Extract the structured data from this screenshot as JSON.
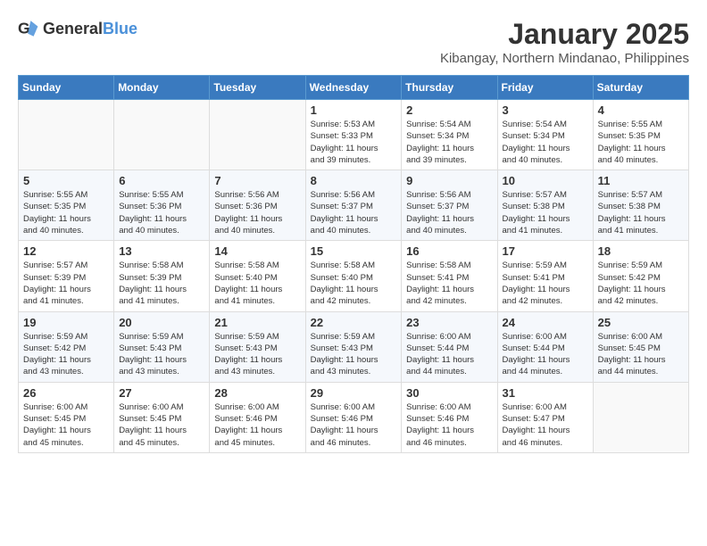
{
  "logo": {
    "general": "General",
    "blue": "Blue"
  },
  "title": "January 2025",
  "subtitle": "Kibangay, Northern Mindanao, Philippines",
  "weekdays": [
    "Sunday",
    "Monday",
    "Tuesday",
    "Wednesday",
    "Thursday",
    "Friday",
    "Saturday"
  ],
  "weeks": [
    [
      {
        "day": "",
        "info": ""
      },
      {
        "day": "",
        "info": ""
      },
      {
        "day": "",
        "info": ""
      },
      {
        "day": "1",
        "info": "Sunrise: 5:53 AM\nSunset: 5:33 PM\nDaylight: 11 hours\nand 39 minutes."
      },
      {
        "day": "2",
        "info": "Sunrise: 5:54 AM\nSunset: 5:34 PM\nDaylight: 11 hours\nand 39 minutes."
      },
      {
        "day": "3",
        "info": "Sunrise: 5:54 AM\nSunset: 5:34 PM\nDaylight: 11 hours\nand 40 minutes."
      },
      {
        "day": "4",
        "info": "Sunrise: 5:55 AM\nSunset: 5:35 PM\nDaylight: 11 hours\nand 40 minutes."
      }
    ],
    [
      {
        "day": "5",
        "info": "Sunrise: 5:55 AM\nSunset: 5:35 PM\nDaylight: 11 hours\nand 40 minutes."
      },
      {
        "day": "6",
        "info": "Sunrise: 5:55 AM\nSunset: 5:36 PM\nDaylight: 11 hours\nand 40 minutes."
      },
      {
        "day": "7",
        "info": "Sunrise: 5:56 AM\nSunset: 5:36 PM\nDaylight: 11 hours\nand 40 minutes."
      },
      {
        "day": "8",
        "info": "Sunrise: 5:56 AM\nSunset: 5:37 PM\nDaylight: 11 hours\nand 40 minutes."
      },
      {
        "day": "9",
        "info": "Sunrise: 5:56 AM\nSunset: 5:37 PM\nDaylight: 11 hours\nand 40 minutes."
      },
      {
        "day": "10",
        "info": "Sunrise: 5:57 AM\nSunset: 5:38 PM\nDaylight: 11 hours\nand 41 minutes."
      },
      {
        "day": "11",
        "info": "Sunrise: 5:57 AM\nSunset: 5:38 PM\nDaylight: 11 hours\nand 41 minutes."
      }
    ],
    [
      {
        "day": "12",
        "info": "Sunrise: 5:57 AM\nSunset: 5:39 PM\nDaylight: 11 hours\nand 41 minutes."
      },
      {
        "day": "13",
        "info": "Sunrise: 5:58 AM\nSunset: 5:39 PM\nDaylight: 11 hours\nand 41 minutes."
      },
      {
        "day": "14",
        "info": "Sunrise: 5:58 AM\nSunset: 5:40 PM\nDaylight: 11 hours\nand 41 minutes."
      },
      {
        "day": "15",
        "info": "Sunrise: 5:58 AM\nSunset: 5:40 PM\nDaylight: 11 hours\nand 42 minutes."
      },
      {
        "day": "16",
        "info": "Sunrise: 5:58 AM\nSunset: 5:41 PM\nDaylight: 11 hours\nand 42 minutes."
      },
      {
        "day": "17",
        "info": "Sunrise: 5:59 AM\nSunset: 5:41 PM\nDaylight: 11 hours\nand 42 minutes."
      },
      {
        "day": "18",
        "info": "Sunrise: 5:59 AM\nSunset: 5:42 PM\nDaylight: 11 hours\nand 42 minutes."
      }
    ],
    [
      {
        "day": "19",
        "info": "Sunrise: 5:59 AM\nSunset: 5:42 PM\nDaylight: 11 hours\nand 43 minutes."
      },
      {
        "day": "20",
        "info": "Sunrise: 5:59 AM\nSunset: 5:43 PM\nDaylight: 11 hours\nand 43 minutes."
      },
      {
        "day": "21",
        "info": "Sunrise: 5:59 AM\nSunset: 5:43 PM\nDaylight: 11 hours\nand 43 minutes."
      },
      {
        "day": "22",
        "info": "Sunrise: 5:59 AM\nSunset: 5:43 PM\nDaylight: 11 hours\nand 43 minutes."
      },
      {
        "day": "23",
        "info": "Sunrise: 6:00 AM\nSunset: 5:44 PM\nDaylight: 11 hours\nand 44 minutes."
      },
      {
        "day": "24",
        "info": "Sunrise: 6:00 AM\nSunset: 5:44 PM\nDaylight: 11 hours\nand 44 minutes."
      },
      {
        "day": "25",
        "info": "Sunrise: 6:00 AM\nSunset: 5:45 PM\nDaylight: 11 hours\nand 44 minutes."
      }
    ],
    [
      {
        "day": "26",
        "info": "Sunrise: 6:00 AM\nSunset: 5:45 PM\nDaylight: 11 hours\nand 45 minutes."
      },
      {
        "day": "27",
        "info": "Sunrise: 6:00 AM\nSunset: 5:45 PM\nDaylight: 11 hours\nand 45 minutes."
      },
      {
        "day": "28",
        "info": "Sunrise: 6:00 AM\nSunset: 5:46 PM\nDaylight: 11 hours\nand 45 minutes."
      },
      {
        "day": "29",
        "info": "Sunrise: 6:00 AM\nSunset: 5:46 PM\nDaylight: 11 hours\nand 46 minutes."
      },
      {
        "day": "30",
        "info": "Sunrise: 6:00 AM\nSunset: 5:46 PM\nDaylight: 11 hours\nand 46 minutes."
      },
      {
        "day": "31",
        "info": "Sunrise: 6:00 AM\nSunset: 5:47 PM\nDaylight: 11 hours\nand 46 minutes."
      },
      {
        "day": "",
        "info": ""
      }
    ]
  ]
}
